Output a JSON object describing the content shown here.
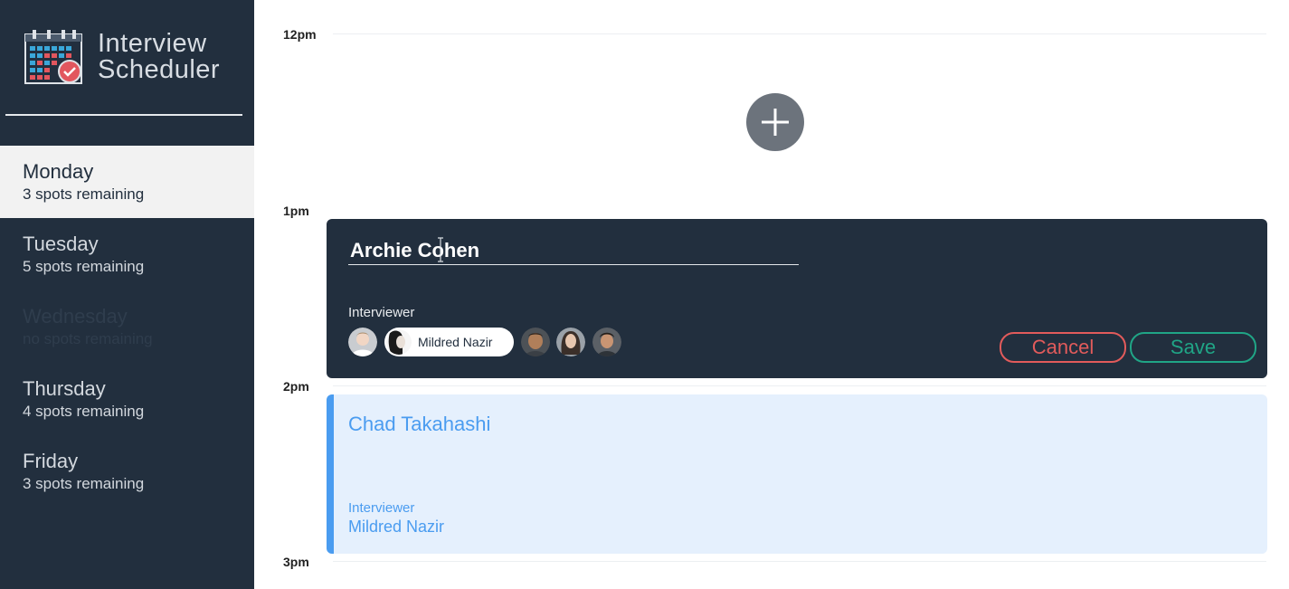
{
  "app": {
    "title_line1": "Interview",
    "title_line2": "Scheduler"
  },
  "days": [
    {
      "name": "Monday",
      "spots": "3 spots remaining",
      "state": "selected"
    },
    {
      "name": "Tuesday",
      "spots": "5 spots remaining",
      "state": "normal"
    },
    {
      "name": "Wednesday",
      "spots": "no spots remaining",
      "state": "full"
    },
    {
      "name": "Thursday",
      "spots": "4 spots remaining",
      "state": "normal"
    },
    {
      "name": "Friday",
      "spots": "3 spots remaining",
      "state": "normal"
    }
  ],
  "times": [
    "12pm",
    "1pm",
    "2pm",
    "3pm"
  ],
  "form": {
    "student_value": "Archie Cohen",
    "interviewer_label": "Interviewer",
    "selected_interviewer": "Mildred Nazir",
    "cancel_label": "Cancel",
    "save_label": "Save"
  },
  "appointment": {
    "student": "Chad Takahashi",
    "interviewer_label": "Interviewer",
    "interviewer_name": "Mildred Nazir"
  },
  "icons": {
    "logo": "calendar-check-icon",
    "add": "plus-icon"
  },
  "colors": {
    "sidebar_bg": "#222f3e",
    "form_bg": "#222f3e",
    "cancel": "#e25b5b",
    "save": "#20a586",
    "appointment_accent": "#4a9cf0",
    "appointment_bg": "#e5f0fd"
  }
}
